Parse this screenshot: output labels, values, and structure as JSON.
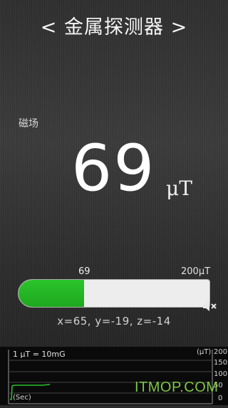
{
  "header": {
    "title": "< 金属探测器 >"
  },
  "meter": {
    "field_label": "磁场",
    "value": "69",
    "unit": "μT"
  },
  "bar": {
    "current_label": "69",
    "max_label": "200μT",
    "fill_fraction": 0.345,
    "fill_color": "#2bc42b"
  },
  "axes_readout": "x=65,  y=-19,  z=-14",
  "graph": {
    "scale_label": "1 μT = 10mG",
    "unit_label": "(μT)",
    "ticks": [
      "200",
      "150",
      "100",
      "50",
      "0"
    ],
    "time_label": "(Sec)",
    "line_color": "#2bc42b"
  },
  "watermark": "ITMOP.COM"
}
